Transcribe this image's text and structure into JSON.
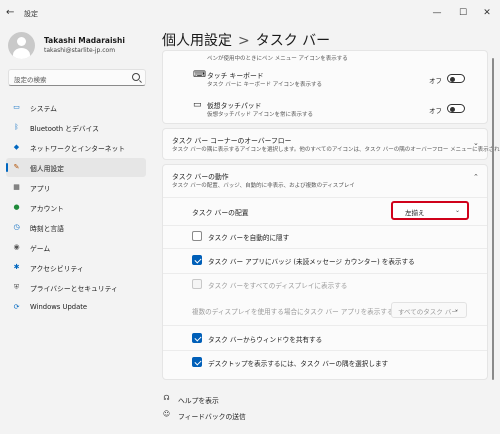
{
  "window": {
    "title": "設定",
    "back_glyph": "←",
    "minimize_glyph": "—",
    "maximize_glyph": "☐",
    "close_glyph": "✕"
  },
  "user": {
    "name": "Takashi Madaraishi",
    "email": "takashi@starlite-jp.com"
  },
  "search": {
    "placeholder": "設定の検索"
  },
  "sidebar": {
    "items": [
      {
        "label": "システム",
        "icon": "monitor-icon",
        "glyph": "▭",
        "color": "#0067c0"
      },
      {
        "label": "Bluetooth とデバイス",
        "icon": "bluetooth-icon",
        "glyph": "ᛒ",
        "color": "#0067c0"
      },
      {
        "label": "ネットワークとインターネット",
        "icon": "network-icon",
        "glyph": "◆",
        "color": "#0067c0"
      },
      {
        "label": "個人用設定",
        "icon": "pen-icon",
        "glyph": "✎",
        "color": "#b25000"
      },
      {
        "label": "アプリ",
        "icon": "apps-icon",
        "glyph": "▦",
        "color": "#444444"
      },
      {
        "label": "アカウント",
        "icon": "account-icon",
        "glyph": "●",
        "color": "#1f8a3a"
      },
      {
        "label": "時刻と言語",
        "icon": "clock-icon",
        "glyph": "◷",
        "color": "#0067c0"
      },
      {
        "label": "ゲーム",
        "icon": "controller-icon",
        "glyph": "◉",
        "color": "#555555"
      },
      {
        "label": "アクセシビリティ",
        "icon": "accessibility-icon",
        "glyph": "✱",
        "color": "#0067c0"
      },
      {
        "label": "プライバシーとセキュリティ",
        "icon": "shield-icon",
        "glyph": "⛨",
        "color": "#555555"
      },
      {
        "label": "Windows Update",
        "icon": "update-icon",
        "glyph": "⟳",
        "color": "#0067c0"
      }
    ],
    "active_index": 3
  },
  "breadcrumb": {
    "parent": "個人用設定",
    "separator": ">",
    "current": "タスク バー"
  },
  "card_top": {
    "cut_text": "ペンが使用中のときにペン メニュー アイコンを表示する",
    "touch_keyboard": {
      "title": "タッチ キーボード",
      "subtitle": "タスク バーに キーボード アイコンを表示する",
      "state_label": "オフ"
    },
    "virtual_touchpad": {
      "title": "仮想タッチパッド",
      "subtitle": "仮想タッチパッド アイコンを常に表示する",
      "state_label": "オフ"
    }
  },
  "overflow": {
    "title": "タスク バー コーナーのオーバーフロー",
    "subtitle": "タスク バーの隅に表示するアイコンを選択します。他のすべてのアイコンは、タスク バーの隅のオーバーフロー メニューに表示されます"
  },
  "behavior": {
    "title": "タスク バーの動作",
    "subtitle": "タスク バーの配置、バッジ、自動的に非表示、および複数のディスプレイ",
    "alignment_label": "タスク バーの配置",
    "alignment_value": "左揃え",
    "auto_hide": "タスク バーを自動的に隠す",
    "badges": "タスク バー アプリにバッジ (未読メッセージ カウンター) を表示する",
    "all_displays": "タスク バーをすべてのディスプレイに表示する",
    "multi_display_label": "複数のディスプレイを使用する場合にタスク バー アプリを表示する場所",
    "multi_display_value": "すべてのタスク バー",
    "share_window": "タスク バーからウィンドウを共有する",
    "desktop_corner": "デスクトップを表示するには、タスク バーの隅を選択します"
  },
  "footer": {
    "help": "ヘルプを表示",
    "feedback": "フィードバックの送信"
  },
  "colors": {
    "accent": "#0067c0",
    "highlight": "#d0021b"
  }
}
